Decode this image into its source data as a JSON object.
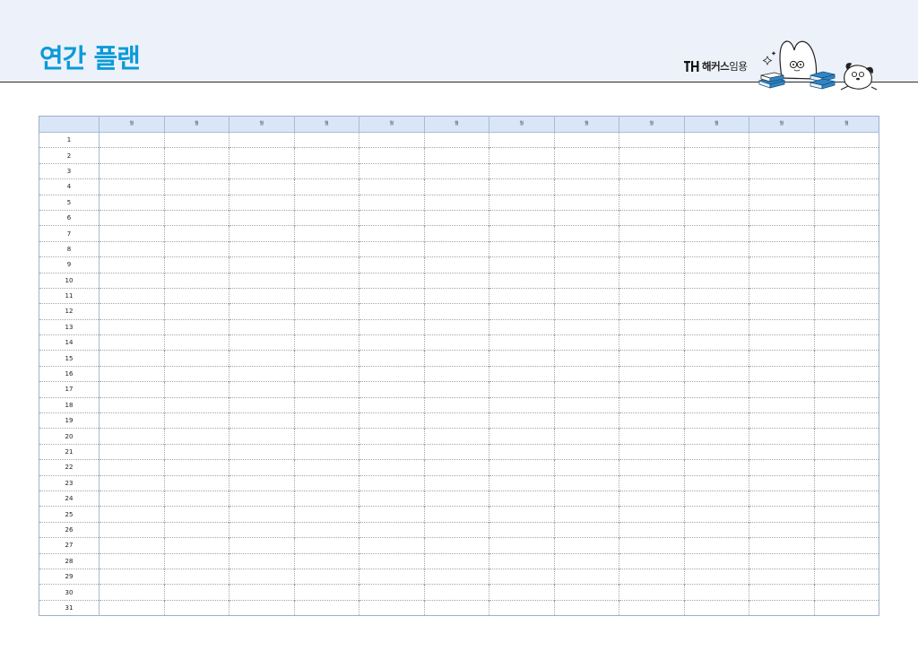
{
  "header": {
    "title": "연간 플랜",
    "brand": {
      "bold": "해커스",
      "light": "임용"
    }
  },
  "planner": {
    "corner_label": "",
    "month_label": "월",
    "month_count": 12,
    "days": [
      "1",
      "2",
      "3",
      "4",
      "5",
      "6",
      "7",
      "8",
      "9",
      "10",
      "11",
      "12",
      "13",
      "14",
      "15",
      "16",
      "17",
      "18",
      "19",
      "20",
      "21",
      "22",
      "23",
      "24",
      "25",
      "26",
      "27",
      "28",
      "29",
      "30",
      "31"
    ]
  },
  "colors": {
    "title": "#0b9bd8",
    "header_bg": "#edf2fa",
    "table_header_bg": "#d8e6f7",
    "book_blue": "#2f86c6"
  },
  "icons": {
    "brand_logo": "hackers-logo-icon",
    "mascot": "rabbit-mascot-icon",
    "books": "book-stack-icon",
    "dog": "dog-mascot-icon"
  }
}
